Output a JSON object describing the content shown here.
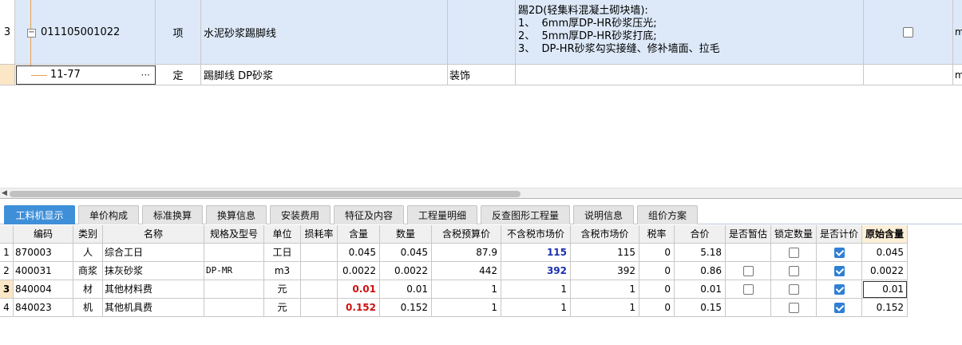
{
  "top_grid": {
    "rows": [
      {
        "index": "3",
        "code": "011105001022",
        "type": "项",
        "name": "水泥砂浆踢脚线",
        "profession": "",
        "features": "踢2D(轻集料混凝土砌块墙):\n1、  6mm厚DP-HR砂浆压光;\n2、  5mm厚DP-HR砂浆打底;\n3、  DP-HR砂浆勾实接缝、修补墙面、拉毛",
        "last": "m"
      },
      {
        "index": "",
        "code": "11-77",
        "type": "定",
        "name": "踢脚线 DP砂浆",
        "profession": "装饰",
        "features": "",
        "last": "m"
      }
    ],
    "expander_symbol": "−",
    "editor_dots": "···"
  },
  "tabs": [
    {
      "label": "工料机显示",
      "active": true
    },
    {
      "label": "单价构成"
    },
    {
      "label": "标准换算"
    },
    {
      "label": "换算信息"
    },
    {
      "label": "安装费用"
    },
    {
      "label": "特征及内容"
    },
    {
      "label": "工程量明细"
    },
    {
      "label": "反查图形工程量"
    },
    {
      "label": "说明信息"
    },
    {
      "label": "组价方案"
    }
  ],
  "bottom_table": {
    "headers": [
      "",
      "编码",
      "类别",
      "名称",
      "规格及型号",
      "单位",
      "损耗率",
      "含量",
      "数量",
      "含税预算价",
      "不含税市场价",
      "含税市场价",
      "税率",
      "合价",
      "是否暂估",
      "锁定数量",
      "是否计价",
      "原始含量"
    ],
    "rows": [
      {
        "idx": "1",
        "code": "870003",
        "cat": "人",
        "name": "综合工日",
        "spec": "",
        "unit": "工日",
        "loss": "",
        "content": "0.045",
        "qty": "0.045",
        "tax_budget": "87.9",
        "notax_market": "115",
        "tax_market": "115",
        "rate": "0",
        "total": "5.18",
        "is_temp": false,
        "lock": false,
        "priced": true,
        "orig": "0.045"
      },
      {
        "idx": "2",
        "code": "400031",
        "cat": "商浆",
        "name": "抹灰砂浆",
        "spec": "DP-MR",
        "unit": "m3",
        "loss": "",
        "content": "0.0022",
        "qty": "0.0022",
        "tax_budget": "442",
        "notax_market": "392",
        "tax_market": "392",
        "rate": "0",
        "total": "0.86",
        "is_temp": false,
        "lock": false,
        "priced": true,
        "orig": "0.0022"
      },
      {
        "idx": "3",
        "code": "840004",
        "cat": "材",
        "name": "其他材料费",
        "spec": "",
        "unit": "元",
        "loss": "",
        "content": "0.01",
        "qty": "0.01",
        "tax_budget": "1",
        "notax_market": "1",
        "tax_market": "1",
        "rate": "0",
        "total": "0.01",
        "is_temp": false,
        "lock": false,
        "priced": true,
        "orig": "0.01"
      },
      {
        "idx": "4",
        "code": "840023",
        "cat": "机",
        "name": "其他机具费",
        "spec": "",
        "unit": "元",
        "loss": "",
        "content": "0.152",
        "qty": "0.152",
        "tax_budget": "1",
        "notax_market": "1",
        "tax_market": "1",
        "rate": "0",
        "total": "0.15",
        "is_temp": null,
        "lock": false,
        "priced": true,
        "orig": "0.152"
      }
    ]
  },
  "colors": {
    "selected_row_bg": "#dde9f9",
    "active_tab_bg": "#3f8fd8",
    "highlight_blue": "#1a2fb0",
    "highlight_red": "#d01010"
  }
}
